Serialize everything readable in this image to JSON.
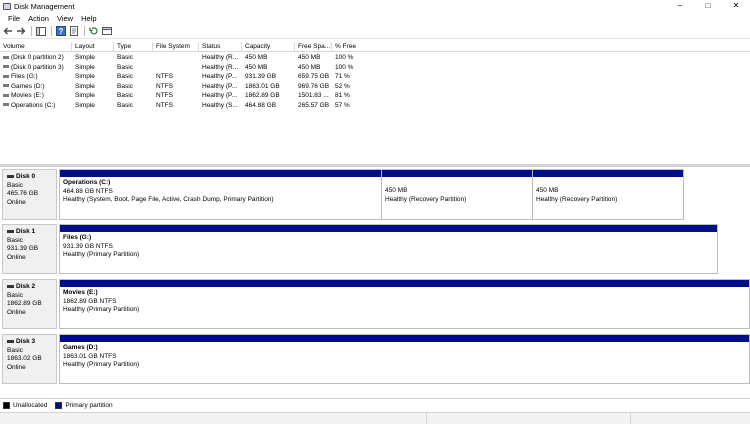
{
  "window": {
    "title": "Disk Management",
    "controls": [
      "–",
      "□",
      "✕"
    ]
  },
  "menu": [
    "File",
    "Action",
    "View",
    "Help"
  ],
  "toolbar": {
    "icons": [
      "back-icon",
      "forward-icon",
      "show-hide-tree-icon",
      "help-icon",
      "properties-icon",
      "refresh-icon",
      "settings-icon"
    ]
  },
  "columns": [
    "Volume",
    "Layout",
    "Type",
    "File System",
    "Status",
    "Capacity",
    "Free Spa...",
    "% Free"
  ],
  "volumes": [
    {
      "volume": "(Disk 0 partition 2)",
      "layout": "Simple",
      "type": "Basic",
      "fs": "",
      "status": "Healthy (R...",
      "capacity": "450 MB",
      "free": "450 MB",
      "pct": "100 %"
    },
    {
      "volume": "(Disk 0 partition 3)",
      "layout": "Simple",
      "type": "Basic",
      "fs": "",
      "status": "Healthy (R...",
      "capacity": "450 MB",
      "free": "450 MB",
      "pct": "100 %"
    },
    {
      "volume": "Files (G:)",
      "layout": "Simple",
      "type": "Basic",
      "fs": "NTFS",
      "status": "Healthy (P...",
      "capacity": "931.39 GB",
      "free": "659.75 GB",
      "pct": "71 %"
    },
    {
      "volume": "Games (D:)",
      "layout": "Simple",
      "type": "Basic",
      "fs": "NTFS",
      "status": "Healthy (P...",
      "capacity": "1863.01 GB",
      "free": "969.76 GB",
      "pct": "52 %"
    },
    {
      "volume": "Movies (E:)",
      "layout": "Simple",
      "type": "Basic",
      "fs": "NTFS",
      "status": "Healthy (P...",
      "capacity": "1862.89 GB",
      "free": "1501.83 ...",
      "pct": "81 %"
    },
    {
      "volume": "Operations (C:)",
      "layout": "Simple",
      "type": "Basic",
      "fs": "NTFS",
      "status": "Healthy (S...",
      "capacity": "464.88 GB",
      "free": "265.57 GB",
      "pct": "57 %"
    }
  ],
  "disks": [
    {
      "name": "Disk 0",
      "type": "Basic",
      "size": "465.76 GB",
      "state": "Online",
      "partitions": [
        {
          "title": "Operations  (C:)",
          "detail": "464.88 GB NTFS",
          "status": "Healthy (System, Boot, Page File, Active, Crash Dump, Primary Partition)"
        },
        {
          "title": "",
          "detail": "450 MB",
          "status": "Healthy (Recovery Partition)"
        },
        {
          "title": "",
          "detail": "450 MB",
          "status": "Healthy (Recovery Partition)"
        }
      ]
    },
    {
      "name": "Disk 1",
      "type": "Basic",
      "size": "931.39 GB",
      "state": "Online",
      "partitions": [
        {
          "title": "Files  (G:)",
          "detail": "931.39 GB NTFS",
          "status": "Healthy (Primary Partition)"
        }
      ]
    },
    {
      "name": "Disk 2",
      "type": "Basic",
      "size": "1862.89 GB",
      "state": "Online",
      "partitions": [
        {
          "title": "Movies  (E:)",
          "detail": "1862.89 GB NTFS",
          "status": "Healthy (Primary Partition)"
        }
      ]
    },
    {
      "name": "Disk 3",
      "type": "Basic",
      "size": "1863.02 GB",
      "state": "Online",
      "partitions": [
        {
          "title": "Games  (D:)",
          "detail": "1863.01 GB NTFS",
          "status": "Healthy (Primary Partition)"
        }
      ]
    }
  ],
  "legend": [
    {
      "label": "Unallocated",
      "color": "#000000"
    },
    {
      "label": "Primary partition",
      "color": "#000f87"
    }
  ]
}
